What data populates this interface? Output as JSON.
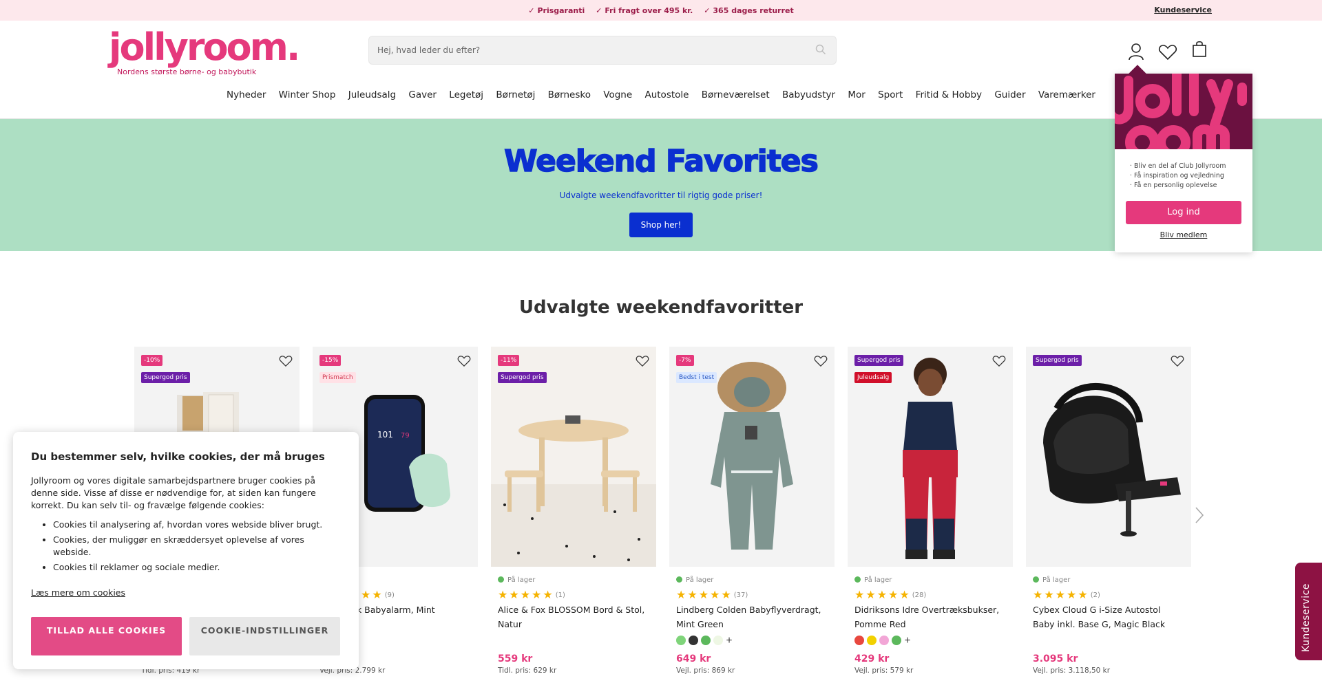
{
  "topbar": {
    "usps": [
      "Prisgaranti",
      "Fri fragt over 495 kr.",
      "365 dages returret"
    ],
    "service_link": "Kundeservice"
  },
  "logo": {
    "name": "jollyroom.",
    "tagline": "Nordens største børne- og babybutik"
  },
  "search": {
    "placeholder": "Hej, hvad leder du efter?"
  },
  "header_icons": [
    "user-icon",
    "heart-icon",
    "cart-icon"
  ],
  "nav": [
    "Nyheder",
    "Winter Shop",
    "Juleudsalg",
    "Gaver",
    "Legetøj",
    "Børnetøj",
    "Børnesko",
    "Vogne",
    "Autostole",
    "Børneværelset",
    "Babyudstyr",
    "Mor",
    "Sport",
    "Fritid & Hobby",
    "Guider",
    "Varemærker"
  ],
  "hero": {
    "title": "Weekend Favorites",
    "subtitle": "Udvalgte weekendfavoritter til rigtig gode priser!",
    "button": "Shop her!"
  },
  "login_popup": {
    "perks": [
      "· Bliv en del af Club Jollyroom",
      "· Få inspiration og vejledning",
      "· Få en personlig oplevelse"
    ],
    "login_button": "Log ind",
    "member_link": "Bliv medlem"
  },
  "section": {
    "title": "Udvalgte weekendfavoritter"
  },
  "products": [
    {
      "badges": [
        "-10%",
        "Supergod pris"
      ],
      "name": "",
      "price": "",
      "old_price": "Tidl. pris: 419 kr",
      "stock": "",
      "reviews": ""
    },
    {
      "badges": [
        "-15%",
        "Prismatch"
      ],
      "name": "eam Sock Babyalarm, Mint",
      "price": "",
      "old_price": "Vejl. pris: 2.799 kr",
      "stock": "",
      "reviews": "(9)"
    },
    {
      "badges": [
        "-11%",
        "Supergod pris"
      ],
      "name": "Alice & Fox BLOSSOM Bord & Stol, Natur",
      "price": "559 kr",
      "old_price": "Tidl. pris: 629 kr",
      "stock": "På lager",
      "reviews": "(1)"
    },
    {
      "badges": [
        "-7%",
        "Bedst i test"
      ],
      "name": "Lindberg Colden Babyflyverdragt, Mint Green",
      "price": "649 kr",
      "old_price": "Vejl. pris: 869 kr",
      "stock": "På lager",
      "reviews": "(37)",
      "swatches": [
        "#7fd47a",
        "#333333",
        "#5cb85c",
        "#eef7e4"
      ]
    },
    {
      "badges": [
        "Supergod pris",
        "Juleudsalg"
      ],
      "name": "Didriksons Idre Overtræksbukser, Pomme Red",
      "price": "429 kr",
      "old_price": "Vejl. pris: 579 kr",
      "stock": "På lager",
      "reviews": "(28)",
      "swatches": [
        "#e8483f",
        "#f2d100",
        "#f2a6d6",
        "#5cb85c"
      ]
    },
    {
      "badges": [
        "Supergod pris"
      ],
      "name": "Cybex Cloud G i-Size Autostol Baby inkl. Base G, Magic Black",
      "price": "3.095 kr",
      "old_price": "Vejl. pris: 3.118,50 kr",
      "stock": "På lager",
      "reviews": "(2)"
    }
  ],
  "cookie": {
    "title": "Du bestemmer selv, hvilke cookies, der må bruges",
    "intro": "Jollyroom og vores digitale samarbejdspartnere bruger cookies på denne side. Visse af disse er nødvendige for, at siden kan fungere korrekt. Du kan selv til- og fravælge følgende cookies:",
    "items": [
      "Cookies til analysering af, hvordan vores webside bliver brugt.",
      "Cookies, der muliggør en skræddersyet oplevelse af vores webside.",
      "Cookies til reklamer og sociale medier."
    ],
    "more_link": "Læs mere om cookies",
    "allow_button": "TILLAD ALLE COOKIES",
    "settings_button": "COOKIE-INDSTILLINGER"
  },
  "side_tab": {
    "label": "Kundeservice"
  },
  "colors": {
    "brand_pink": "#e5397c",
    "hero_green": "#addfc3",
    "hero_blue": "#0a2fd0",
    "plum": "#6b1140"
  }
}
